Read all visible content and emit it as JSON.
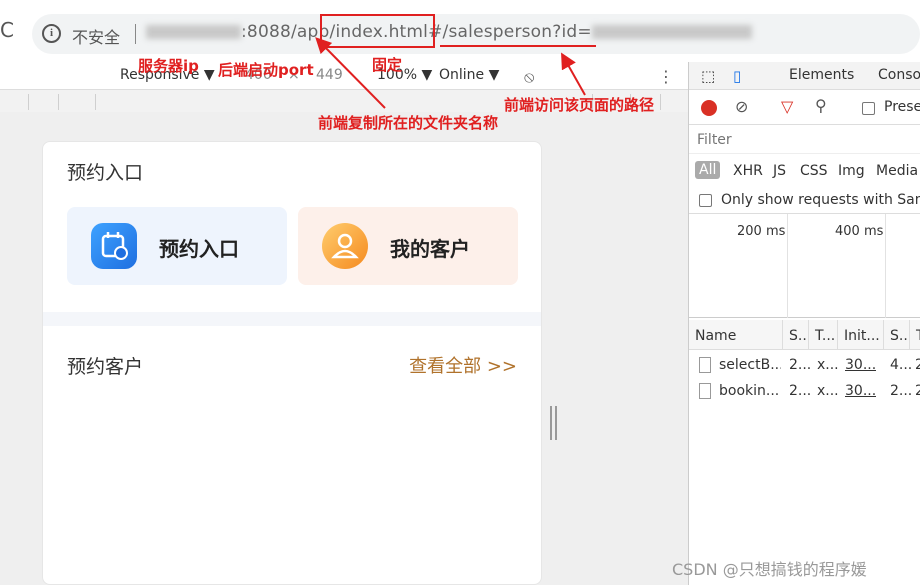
{
  "address_bar": {
    "insecure_label": "不安全",
    "url_port_segment": ":8088/app/",
    "url_fixed_segment": "index.html#",
    "url_path_segment": "/salesperson?id="
  },
  "device_toolbar": {
    "device": "Responsive ▼",
    "width": "400",
    "times": "×",
    "height": "449",
    "zoom": "100% ▼",
    "network": "Online ▼"
  },
  "page": {
    "section1_title": "预约入口",
    "card1_label": "预约入口",
    "card2_label": "我的客户",
    "section2_title": "预约客户",
    "view_all": "查看全部 >>"
  },
  "devtools": {
    "tabs": [
      "Elements",
      "Conso"
    ],
    "preserve_label": "Prese",
    "filter_placeholder": "Filter",
    "types": [
      "All",
      "XHR",
      "JS",
      "CSS",
      "Img",
      "Media"
    ],
    "only_requests": "Only show requests with Same",
    "ticks": [
      "200 ms",
      "400 ms"
    ],
    "columns": [
      "Name",
      "S..",
      "T...",
      "Init...",
      "S..",
      "T"
    ],
    "rows": [
      [
        "selectB...",
        "2...",
        "x...",
        "30...",
        "4...",
        "2"
      ],
      [
        "bookin...",
        "2...",
        "x...",
        "30...",
        "2...",
        "2"
      ]
    ]
  },
  "annotations": {
    "server_ip": "服务器ip",
    "backend_port": "后端启动port",
    "fixed": "固定",
    "frontend_folder": "前端复制所在的文件夹名称",
    "frontend_path": "前端访问该页面的路径"
  },
  "watermark": "CSDN @只想搞钱的程序媛",
  "colors": {
    "annotation": "#e02020",
    "link": "#b0722b",
    "record": "#d93025"
  }
}
